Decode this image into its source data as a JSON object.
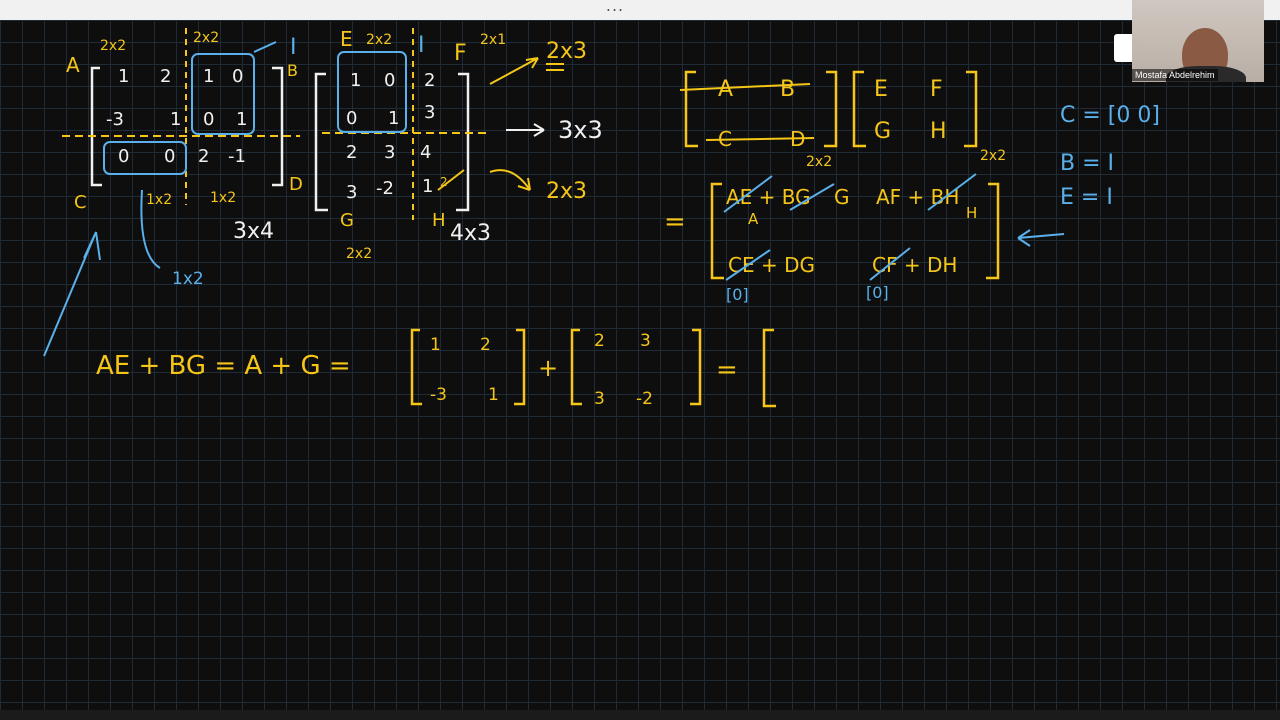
{
  "topbar": {
    "menu_dots": "..."
  },
  "video": {
    "participant_name": "Mostafa Abdelrehim"
  },
  "whiteboard": {
    "matrix1": {
      "label_A": "A",
      "dim_A": "2x2",
      "dim_B_top": "2x2",
      "label_I_B": "I",
      "label_B": "B",
      "r1": [
        "1",
        "2",
        "1",
        "0"
      ],
      "r2": [
        "-3",
        "1",
        "0",
        "1"
      ],
      "r3": [
        "0",
        "0",
        "2",
        "-1"
      ],
      "label_C": "C",
      "dim_C": "1x2",
      "dim_D": "1x2",
      "label_D": "D",
      "dim_C_arrow": "1x2",
      "size": "3x4"
    },
    "matrix2": {
      "label_E": "E",
      "dim_E": "2x2",
      "label_I_E": "I",
      "label_F": "F",
      "dim_F": "2x1",
      "r1": [
        "1",
        "0",
        "2"
      ],
      "r2": [
        "0",
        "1",
        "3"
      ],
      "r3": [
        "2",
        "3",
        "4"
      ],
      "r4": [
        "3",
        "-2",
        "1"
      ],
      "r4_crossed": "2",
      "label_G": "G",
      "dim_G": "2x2",
      "label_H": "H",
      "size": "4x3"
    },
    "arrows": {
      "top": "2x3",
      "middle": "3x3",
      "bottom": "2x3"
    },
    "block": {
      "A": "A",
      "B": "B",
      "C": "C",
      "D": "D",
      "E": "E",
      "F": "F",
      "G": "G",
      "H": "H",
      "dim1": "2x2",
      "dim2": "2x2",
      "tl": "AE + BG",
      "tl_sub": "A",
      "tl_g": "G",
      "tr": "AF + BH",
      "tr_sub": "H",
      "bl": "CE + DG",
      "bl_sub": "[0]",
      "br": "CF + DH",
      "br_sub": "[0]",
      "equals": "="
    },
    "notes": [
      "C = [0 0]",
      "B = I",
      "E = I"
    ],
    "equation": {
      "lhs": "AE + BG = A + G =",
      "m1": [
        "1",
        "2",
        "-3",
        "1"
      ],
      "plus": "+",
      "m2": [
        "2",
        "3",
        "3",
        "-2"
      ],
      "equals": "="
    }
  },
  "colors": {
    "yellow": "#f5c518",
    "white": "#f0f0f0",
    "blue": "#5ab0ea",
    "grid": "#1f2b37"
  }
}
